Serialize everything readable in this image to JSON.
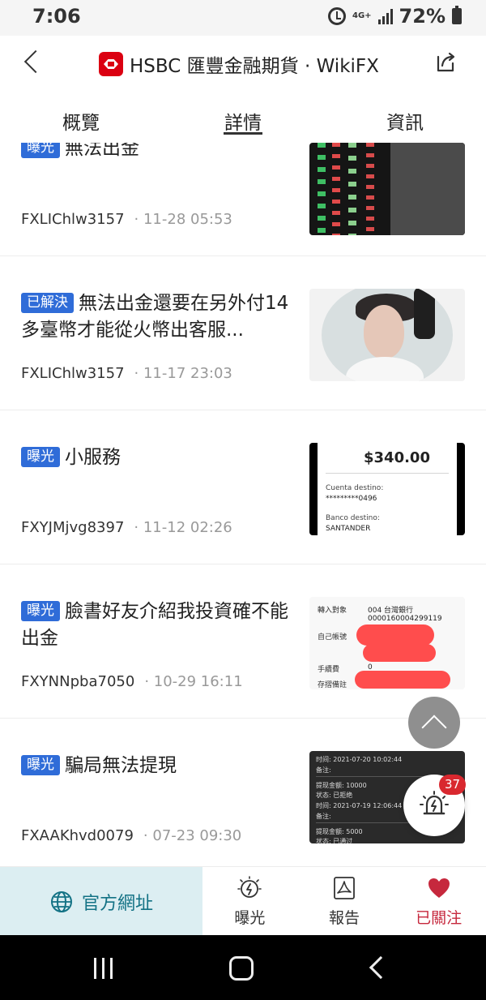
{
  "status_bar": {
    "time": "7:06",
    "network": "4G+",
    "battery_percent": "72%"
  },
  "header": {
    "title": "HSBC 匯豐金融期貨 · WikiFX",
    "logo_icon": "hsbc-logo",
    "back_icon": "chevron-left-icon",
    "share_icon": "share-icon"
  },
  "tabs": [
    {
      "label": "概覽",
      "active": false
    },
    {
      "label": "詳情",
      "active": true
    },
    {
      "label": "資訊",
      "active": false
    }
  ],
  "items": [
    {
      "badge": "曝光",
      "title": "無法出金",
      "author": "FXLIChlw3157",
      "time": "· 11-28 05:53",
      "image_type": "stock-board-photo"
    },
    {
      "badge": "已解決",
      "title": "無法出金還要在另外付14多臺幣才能從火幣出客服...",
      "author": "FXLIChlw3157",
      "time": "· 11-17 23:03",
      "image_type": "selfie-photo"
    },
    {
      "badge": "曝光",
      "title": "小服務",
      "author": "FXYJMjvg8397",
      "time": "· 11-12 02:26",
      "image_type": "receipt-screenshot",
      "image_text": {
        "amount": "$340.00",
        "destination_label": "Cuenta destino:",
        "destination_value": "*********0496",
        "bank_label": "Banco destino:",
        "bank_value": "SANTANDER"
      }
    },
    {
      "badge": "曝光",
      "title": "臉書好友介紹我投資確不能出金",
      "author": "FXYNNpba7050",
      "time": "· 10-29 16:11",
      "image_type": "bank-transfer-screenshot",
      "image_text": {
        "recipient_label": "轉入對象",
        "bank_name": "004 台灣銀行",
        "account_number": "0000160004299119",
        "own_account_label": "自己帳號",
        "fee_label": "手續費",
        "fee_value": "0",
        "note_label": "存摺備註"
      }
    },
    {
      "badge": "曝光",
      "title": "騙局無法提現",
      "author": "FXAAKhvd0079",
      "time": "· 07-23 09:30",
      "image_type": "withdrawal-record-screenshot",
      "image_text": {
        "line_1": "时间: 2021-07-20 10:02:44",
        "line_2": "备注:",
        "line_3": "提现金额: 10000",
        "line_4": "状态: 已拒绝",
        "line_5": "时间: 2021-07-19 12:06:44",
        "line_6": "备注:",
        "line_7": "提现金额: 5000",
        "line_8": "状态: 已通过"
      }
    }
  ],
  "floating": {
    "scroll_top_icon": "chevron-up-icon",
    "exposure_count": "37",
    "exposure_icon": "alarm-light-icon"
  },
  "bottom_bar": {
    "official_site_label": "官方網址",
    "exposure_label": "曝光",
    "report_label": "報告",
    "followed_label": "已關注",
    "colors": {
      "official_bg": "#dceef2",
      "official_text": "#137285",
      "followed": "#c6283d"
    }
  },
  "system_nav": {
    "recents_icon": "recents-icon",
    "home_icon": "home-icon",
    "back_icon": "back-icon"
  }
}
